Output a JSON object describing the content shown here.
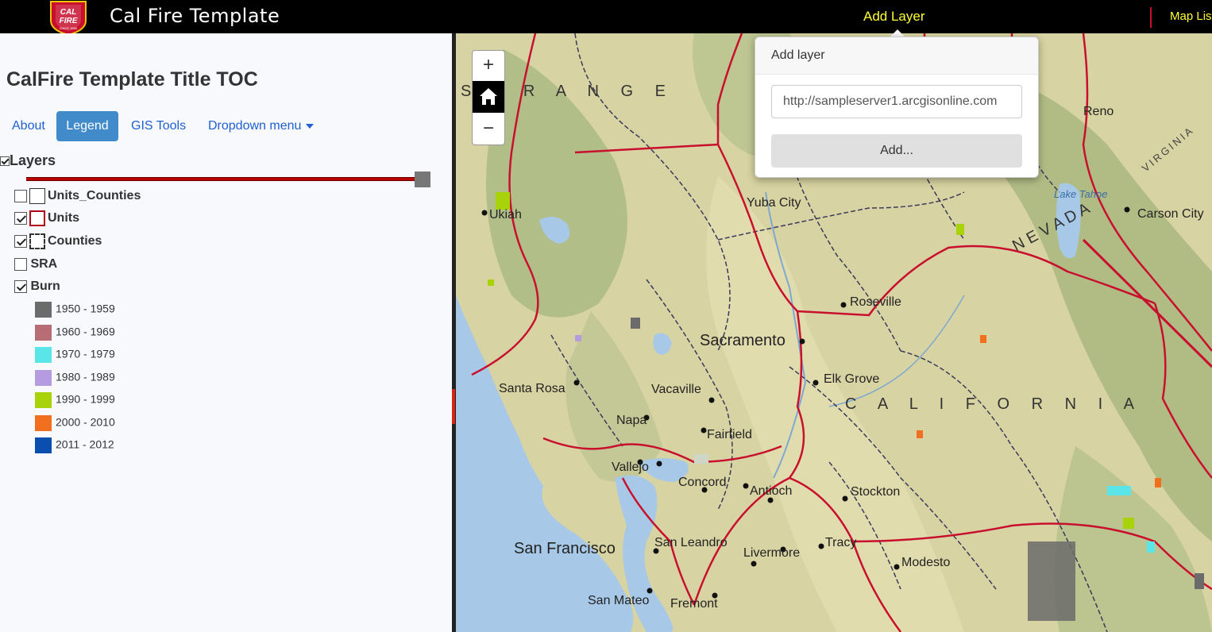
{
  "app": {
    "title": "Cal Fire Template",
    "logo_text_top": "CAL",
    "logo_text_bottom": "FIRE",
    "logo_text_since": "SINCE 1885"
  },
  "topnav": {
    "add_layer": "Add Layer",
    "map_list": "Map List"
  },
  "toc": {
    "title": "CalFire Template Title TOC",
    "tabs": [
      {
        "label": "About",
        "active": false
      },
      {
        "label": "Legend",
        "active": true
      },
      {
        "label": "GIS Tools",
        "active": false
      },
      {
        "label": "Dropdown menu",
        "active": false
      }
    ],
    "layers_label": "Layers",
    "layers": [
      {
        "label": "Units_Counties",
        "checked": false
      },
      {
        "label": "Units",
        "checked": true
      },
      {
        "label": "Counties",
        "checked": true
      },
      {
        "label": "SRA",
        "checked": false
      },
      {
        "label": "Burn",
        "checked": true
      }
    ],
    "legend": [
      {
        "label": "1950 - 1959",
        "color": "#6b6b6b"
      },
      {
        "label": "1960 - 1969",
        "color": "#b86d75"
      },
      {
        "label": "1970 - 1979",
        "color": "#5ae6e8"
      },
      {
        "label": "1980 - 1989",
        "color": "#b59be0"
      },
      {
        "label": "1990 - 1999",
        "color": "#a8d20a"
      },
      {
        "label": "2000 - 2010",
        "color": "#f07020"
      },
      {
        "label": "2011 - 2012",
        "color": "#0a4fb0"
      }
    ]
  },
  "map": {
    "zoom_in": "+",
    "zoom_out": "−",
    "labels": {
      "range": "S L R A N G E",
      "reno": "Reno",
      "yuba_city": "Yuba City",
      "ukiah": "Ukiah",
      "carson_city": "Carson City",
      "lake_tahoe": "Lake Tahoe",
      "roseville": "Roseville",
      "sacramento": "Sacramento",
      "elk_grove": "Elk Grove",
      "california": "C A L I F O R N I A",
      "santa_rosa": "Santa Rosa",
      "vacaville": "Vacaville",
      "napa": "Napa",
      "fairfield": "Fairfield",
      "vallejo": "Vallejo",
      "concord": "Concord",
      "antioch": "Antioch",
      "stockton": "Stockton",
      "san_francisco": "San Francisco",
      "san_leandro": "San Leandro",
      "livermore": "Livermore",
      "tracy": "Tracy",
      "modesto": "Modesto",
      "san_mateo": "San Mateo",
      "fremont": "Fremont",
      "virginia": "VIRGINIA",
      "nevada": "N E V A D A"
    }
  },
  "popup": {
    "title": "Add layer",
    "input_value": "http://sampleserver1.arcgisonline.com",
    "button": "Add..."
  },
  "colors": {
    "accent": "#428bca",
    "topnav_link": "#ffff33",
    "boundary": "#c8102e"
  }
}
